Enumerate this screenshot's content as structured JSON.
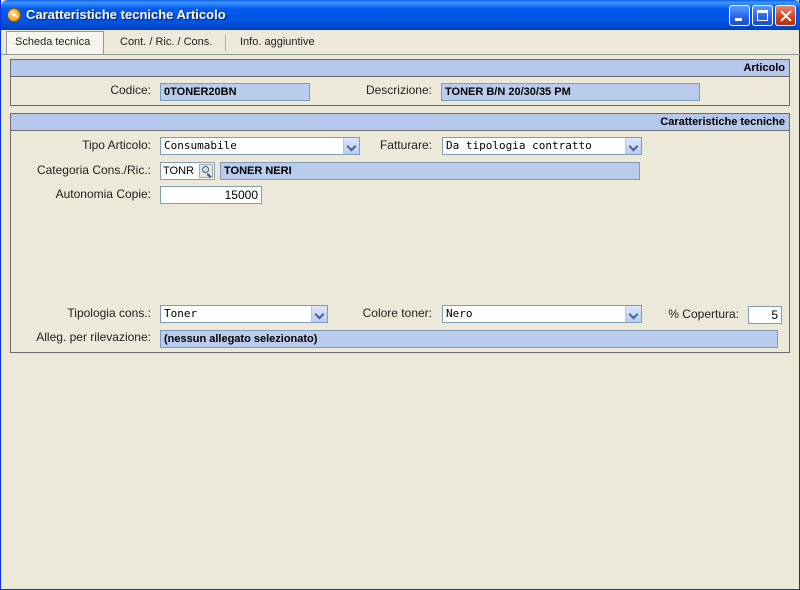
{
  "window": {
    "title": "Caratteristiche tecniche Articolo"
  },
  "tabs": [
    {
      "label": "Scheda tecnica",
      "active": true
    },
    {
      "label": "Cont. / Ric. / Cons.",
      "active": false
    },
    {
      "label": "Info. aggiuntive",
      "active": false
    }
  ],
  "articolo": {
    "header": "Articolo",
    "codice_label": "Codice:",
    "codice_value": "0TONER20BN",
    "descrizione_label": "Descrizione:",
    "descrizione_value": "TONER B/N 20/30/35 PM"
  },
  "caratteristiche": {
    "header": "Caratteristiche tecniche",
    "tipo_articolo_label": "Tipo Articolo:",
    "tipo_articolo_value": "Consumabile",
    "fatturare_label": "Fatturare:",
    "fatturare_value": "Da tipologia contratto",
    "categoria_label": "Categoria Cons./Ric.:",
    "categoria_code": "TONR",
    "categoria_desc": "TONER NERI",
    "autonomia_label": "Autonomia Copie:",
    "autonomia_value": "15000",
    "tipologia_label": "Tipologia cons.:",
    "tipologia_value": "Toner",
    "colore_label": "Colore toner:",
    "colore_value": "Nero",
    "copertura_label": "% Copertura:",
    "copertura_value": "5",
    "alleg_label": "Alleg. per rilevazione:",
    "alleg_value": "(nessun allegato selezionato)"
  },
  "colors": {
    "titlebar": "#0054E3",
    "panel_header": "#B5C8EC",
    "readonly_field": "#B9CCEE",
    "window_bg": "#ECE9D8"
  }
}
